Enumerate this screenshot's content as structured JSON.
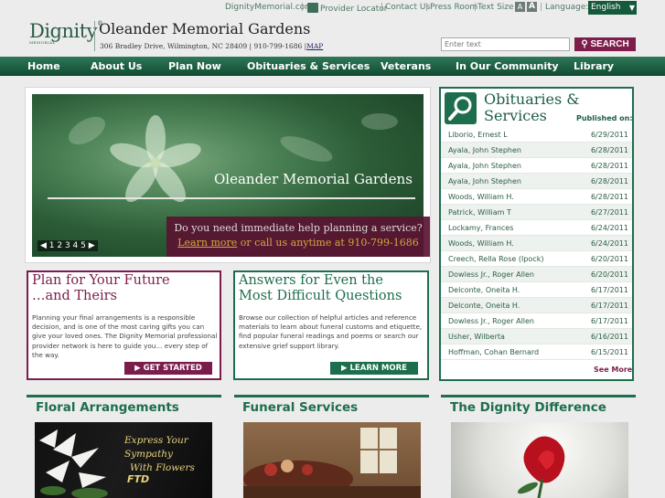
{
  "topbar": {
    "dignity_link": "DignityMemorial.com",
    "provider_locator": "Provider Locator",
    "contact_us": "Contact Us",
    "press_room": "Press Room",
    "text_size_label": "Text Size",
    "text_size_small": "A",
    "text_size_large": "A",
    "language_label": "Language:",
    "language_value": "English"
  },
  "header": {
    "logo_text": "Dignity",
    "logo_sub": "MEMORIAL",
    "site_title": "Oleander Memorial Gardens",
    "address": "306 Bradley Drive, Wilmington, NC 28409 | 910-799-1686 |",
    "map_link": "MAP",
    "search_placeholder": "Enter text",
    "search_button": "SEARCH"
  },
  "nav": {
    "items": [
      "Home",
      "About Us",
      "Plan Now",
      "Obituaries & Services",
      "Veterans",
      "In Our Community",
      "Library"
    ]
  },
  "hero": {
    "title": "Oleander Memorial Gardens",
    "callout_line1": "Do you need immediate help planning a service?",
    "learn_more": "Learn more",
    "callout_line2": "or call us anytime at 910-799-1686",
    "pager": "◀ 1 2 3 4 5 ▶"
  },
  "plan": {
    "title_line1": "Plan for Your Future",
    "title_line2": "…and Theirs",
    "body": "Planning your final arrangements is a responsible decision, and is one of the most caring gifts you can give your loved ones. The Dignity Memorial professional provider network is here to guide you… every step of the way.",
    "button": "▶ GET STARTED"
  },
  "answers": {
    "title_line1": "Answers for Even the",
    "title_line2": "Most Difficult Questions",
    "body": "Browse our collection of helpful articles and reference materials to learn about funeral customs and etiquette, find popular funeral readings and poems or search our extensive grief support library.",
    "button": "▶ LEARN MORE"
  },
  "obituaries": {
    "title_line1": "Obituaries &",
    "title_line2": "Services",
    "published_label": "Published on:",
    "rows": [
      {
        "name": "Liborio, Ernest L",
        "date": "6/29/2011"
      },
      {
        "name": "Ayala, John Stephen",
        "date": "6/28/2011"
      },
      {
        "name": "Ayala, John Stephen",
        "date": "6/28/2011"
      },
      {
        "name": "Ayala, John Stephen",
        "date": "6/28/2011"
      },
      {
        "name": "Woods, William H.",
        "date": "6/28/2011"
      },
      {
        "name": "Patrick, William T",
        "date": "6/27/2011"
      },
      {
        "name": "Lockamy, Frances",
        "date": "6/24/2011"
      },
      {
        "name": "Woods, William H.",
        "date": "6/24/2011"
      },
      {
        "name": "Creech, Rella Rose (Ipock)",
        "date": "6/20/2011"
      },
      {
        "name": "Dowless Jr., Roger Allen",
        "date": "6/20/2011"
      },
      {
        "name": "Delconte, Oneita H.",
        "date": "6/17/2011"
      },
      {
        "name": "Delconte, Oneita H.",
        "date": "6/17/2011"
      },
      {
        "name": "Dowless Jr., Roger Allen",
        "date": "6/17/2011"
      },
      {
        "name": "Usher, Wilberta",
        "date": "6/16/2011"
      },
      {
        "name": "Hoffman, Cohan Bernard",
        "date": "6/15/2011"
      }
    ],
    "see_more": "See More"
  },
  "sections": {
    "floral": {
      "title": "Floral Arrangements",
      "image_line1": "Express Your Sympathy",
      "image_line2": "With Flowers",
      "image_logo": "FTD"
    },
    "funeral": {
      "title": "Funeral Services"
    },
    "dignity": {
      "title": "The Dignity Difference"
    }
  },
  "colors": {
    "green": "#1d6e4d",
    "maroon": "#7a1d4a",
    "gold": "#d7a640"
  }
}
